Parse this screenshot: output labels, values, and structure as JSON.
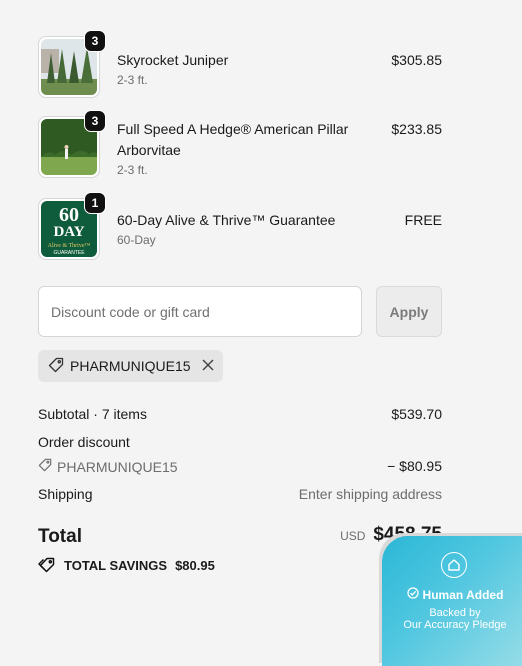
{
  "items": [
    {
      "name": "Skyrocket Juniper",
      "variant": "2-3 ft.",
      "price": "$305.85",
      "qty": "3"
    },
    {
      "name": "Full Speed A Hedge® American Pillar Arborvitae",
      "variant": "2-3 ft.",
      "price": "$233.85",
      "qty": "3"
    },
    {
      "name": "60-Day Alive & Thrive™ Guarantee",
      "variant": "60-Day",
      "price": "FREE",
      "qty": "1",
      "image_text": {
        "line1": "60",
        "line2": "DAY",
        "line3": "Alive & Thrive™",
        "line4": "GUARANTEE"
      }
    }
  ],
  "discount": {
    "placeholder": "Discount code or gift card",
    "value": "",
    "apply_label": "Apply"
  },
  "applied_code": "PHARMUNIQUE15",
  "summary": {
    "subtotal_label": "Subtotal · 7 items",
    "subtotal_value": "$539.70",
    "order_discount_label": "Order discount",
    "discount_code": "PHARMUNIQUE15",
    "discount_value": "− $80.95",
    "shipping_label": "Shipping",
    "shipping_value": "Enter shipping address",
    "total_label": "Total",
    "currency": "USD",
    "total_value": "$458.75",
    "savings_label": "TOTAL SAVINGS",
    "savings_value": "$80.95"
  },
  "badge": {
    "title": "Human Added",
    "line1": "Backed by",
    "line2": "Our Accuracy Pledge"
  },
  "colors": {
    "guarantee_green": "#0f5c3c",
    "badge_blue": "#2ab7d6",
    "chip_bg": "#e5e5e5"
  }
}
